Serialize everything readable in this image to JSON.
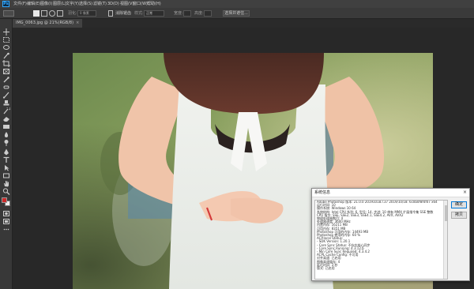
{
  "app": {
    "logo": "Ps"
  },
  "menu": [
    "文件(F)",
    "编辑(E)",
    "图像(I)",
    "图层(L)",
    "文字(Y)",
    "选择(S)",
    "滤镜(T)",
    "3D(D)",
    "视图(V)",
    "窗口(W)",
    "帮助(H)"
  ],
  "options": {
    "feather_label": "羽化:",
    "feather_value": "0 像素",
    "antialias_label": "消除锯齿",
    "style_label": "样式:",
    "style_value": "正常",
    "width_label": "宽度:",
    "height_label": "高度:",
    "select_mask_button": "选择并遮住..."
  },
  "document": {
    "tab_title": "IMG_0063.jpg @ 21%(RGB/8)",
    "tab_close": "×"
  },
  "toolbar": {
    "tools": [
      "move-icon",
      "marquee-icon",
      "lasso-icon",
      "quick-select-icon",
      "crop-icon",
      "frame-icon",
      "eyedropper-icon",
      "healing-icon",
      "brush-icon",
      "clone-stamp-icon",
      "history-brush-icon",
      "eraser-icon",
      "gradient-icon",
      "blur-icon",
      "dodge-icon",
      "pen-icon",
      "type-icon",
      "path-select-icon",
      "rectangle-icon",
      "hand-icon",
      "zoom-icon",
      "edit-toolbar-icon"
    ],
    "foreground_color": "#cc2a2a",
    "background_color": "#f0f0f0"
  },
  "dialog": {
    "title": "系统信息",
    "close": "×",
    "ok_button": "确定",
    "copy_button": "拷贝",
    "info_lines": [
      "Adobe Photoshop 版本: 21.0.0 20191018.r.37 2019/10/18: 6c0b0f8f4f07 x64",
      "运行时间: 10",
      "操作系统: Windows 10 64",
      "系统结构: Intel CPU 系列: 6, 型号: 14, 步进: 10 带有 MMX 扩展指令集 SSE 整数",
      "CPU 指令: SSE, SSE2, SSE3, SSE4.1, SSE4.2, AVX, AVX2",
      "物理处理器数目: 4",
      "处理器速度: 3600 MHz",
      "内置内存: 16211 MB",
      "可用内存: 8351 MB",
      "Photoshop 可用的内存: 14493 MB",
      "Photoshop 使用的内存: 60 %",
      "ACP.local Status:",
      "- SDK Version: 1.20.1",
      "- Core Sync Status: 不存在核心同步",
      "- Core Sync Running: 4.3.12.6",
      "- Min Core Sync Required: 4.3.4.2",
      "ACPL Cache Config: 不可用",
      "对齐高速: 已启用",
      "图像高速缓存: 4",
      "延迟时间: 3 秒",
      "版式: 已启用"
    ]
  }
}
